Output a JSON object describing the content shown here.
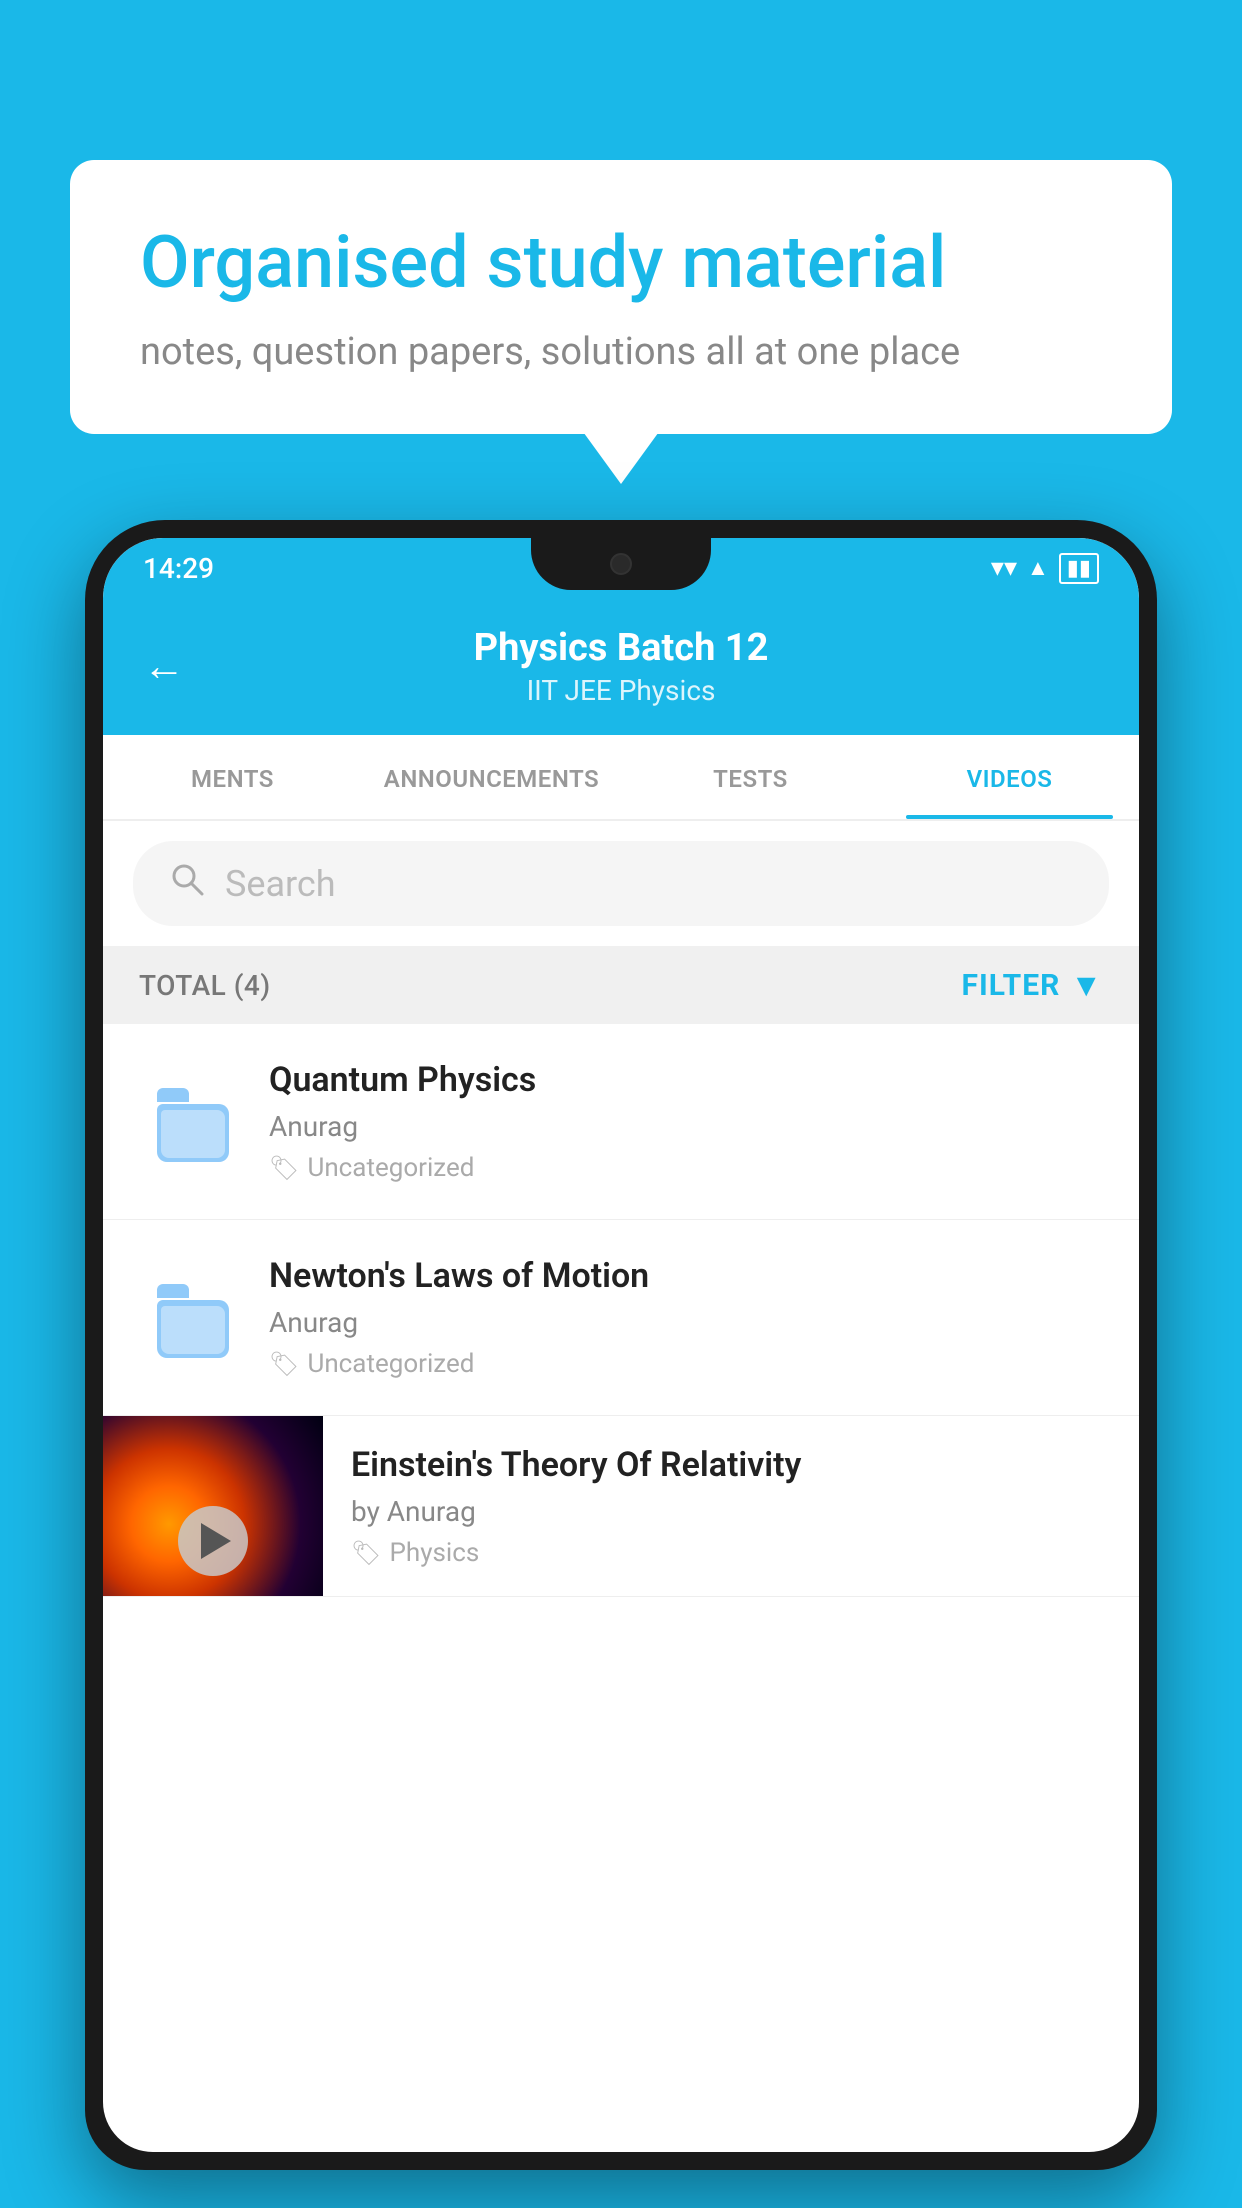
{
  "background_color": "#1ab8e8",
  "speech_bubble": {
    "title": "Organised study material",
    "subtitle": "notes, question papers, solutions all at one place"
  },
  "phone": {
    "status_bar": {
      "time": "14:29",
      "icons": [
        "wifi",
        "signal",
        "battery"
      ]
    },
    "app_header": {
      "back_label": "←",
      "title": "Physics Batch 12",
      "subtitle": "IIT JEE   Physics"
    },
    "tabs": [
      {
        "label": "MENTS",
        "active": false
      },
      {
        "label": "ANNOUNCEMENTS",
        "active": false
      },
      {
        "label": "TESTS",
        "active": false
      },
      {
        "label": "VIDEOS",
        "active": true
      }
    ],
    "search": {
      "placeholder": "Search"
    },
    "filter_bar": {
      "total_label": "TOTAL (4)",
      "filter_label": "FILTER"
    },
    "videos": [
      {
        "type": "folder",
        "title": "Quantum Physics",
        "author": "Anurag",
        "tag": "Uncategorized"
      },
      {
        "type": "folder",
        "title": "Newton's Laws of Motion",
        "author": "Anurag",
        "tag": "Uncategorized"
      },
      {
        "type": "thumbnail",
        "title": "Einstein's Theory Of Relativity",
        "author": "by Anurag",
        "tag": "Physics"
      }
    ]
  }
}
